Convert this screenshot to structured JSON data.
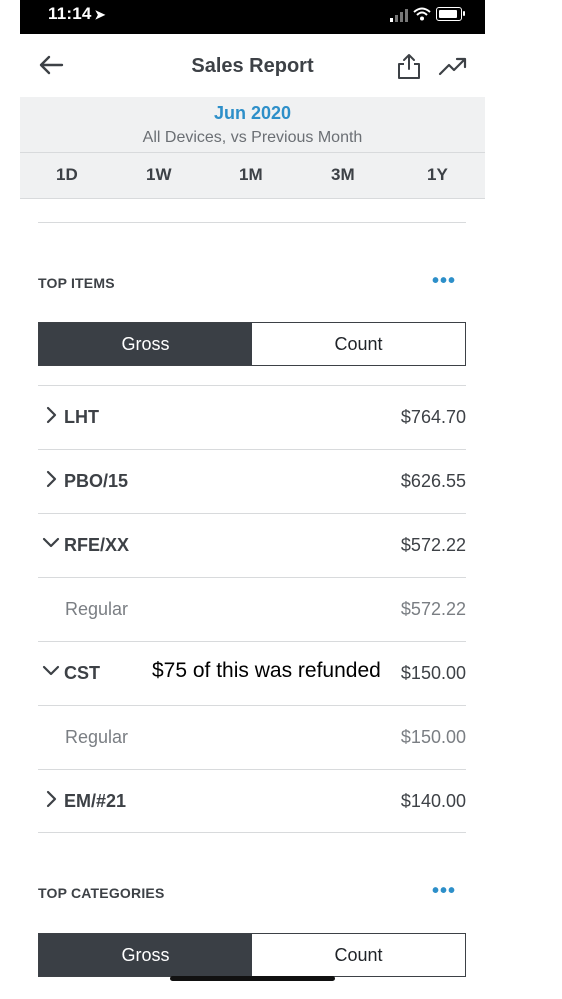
{
  "status": {
    "time": "11:14",
    "location_icon": "location-arrow-icon"
  },
  "header": {
    "title": "Sales Report",
    "icons": [
      "back-arrow-icon",
      "share-icon",
      "trend-icon"
    ]
  },
  "period": {
    "label": "Jun 2020",
    "subtitle": "All Devices, vs Previous Month",
    "ranges": [
      "1D",
      "1W",
      "1M",
      "3M",
      "1Y"
    ]
  },
  "top_items": {
    "title": "TOP ITEMS",
    "more": "•••",
    "toggle": {
      "gross": "Gross",
      "count": "Count",
      "selected": "Gross"
    },
    "rows": [
      {
        "name": "LHT",
        "amount": "$764.70",
        "expanded": false
      },
      {
        "name": "PBO/15",
        "amount": "$626.55",
        "expanded": false
      },
      {
        "name": "RFE/XX",
        "amount": "$572.22",
        "expanded": true
      },
      {
        "name": "Regular",
        "amount": "$572.22",
        "sub": true
      },
      {
        "name": "CST",
        "amount": "$150.00",
        "expanded": true
      },
      {
        "name": "Regular",
        "amount": "$150.00",
        "sub": true
      },
      {
        "name": "EM/#21",
        "amount": "$140.00",
        "expanded": false
      }
    ]
  },
  "annotation": "$75 of this was refunded",
  "top_categories": {
    "title": "TOP CATEGORIES",
    "more": "•••",
    "toggle": {
      "gross": "Gross",
      "count": "Count",
      "selected": "Gross"
    }
  },
  "colors": {
    "accent": "#2d8fc9",
    "dark": "#3a3f45",
    "muted": "#7a7e83"
  }
}
